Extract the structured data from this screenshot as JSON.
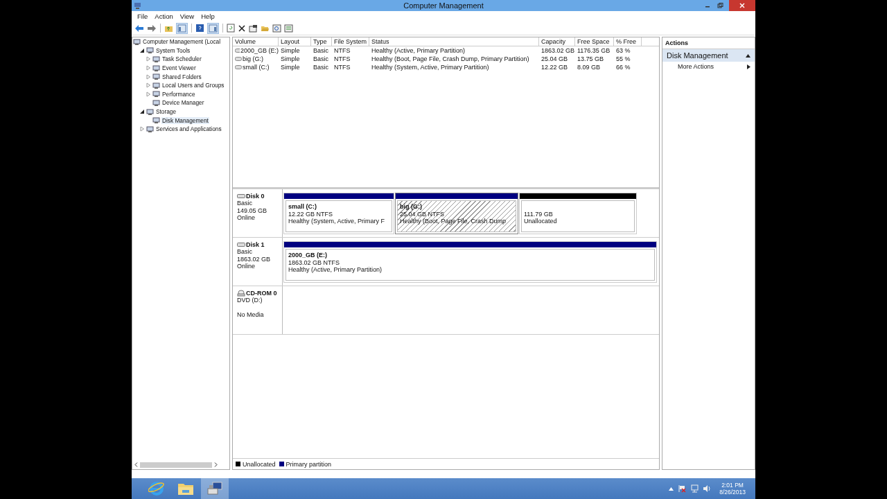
{
  "window": {
    "title": "Computer Management"
  },
  "menu": [
    "File",
    "Action",
    "View",
    "Help"
  ],
  "tree": [
    {
      "label": "Computer Management (Local",
      "expandable": false,
      "selected": false,
      "children": [
        {
          "label": "System Tools",
          "expandable": true,
          "expanded": true,
          "selected": false,
          "children": [
            {
              "label": "Task Scheduler",
              "expandable": true,
              "expanded": false,
              "selected": false
            },
            {
              "label": "Event Viewer",
              "expandable": true,
              "expanded": false,
              "selected": false
            },
            {
              "label": "Shared Folders",
              "expandable": true,
              "expanded": false,
              "selected": false
            },
            {
              "label": "Local Users and Groups",
              "expandable": true,
              "expanded": false,
              "selected": false
            },
            {
              "label": "Performance",
              "expandable": true,
              "expanded": false,
              "selected": false
            },
            {
              "label": "Device Manager",
              "expandable": false,
              "selected": false
            }
          ]
        },
        {
          "label": "Storage",
          "expandable": true,
          "expanded": true,
          "selected": false,
          "children": [
            {
              "label": "Disk Management",
              "expandable": false,
              "selected": true
            }
          ]
        },
        {
          "label": "Services and Applications",
          "expandable": true,
          "expanded": false,
          "selected": false
        }
      ]
    }
  ],
  "table": {
    "columns": [
      "Volume",
      "Layout",
      "Type",
      "File System",
      "Status",
      "Capacity",
      "Free Space",
      "% Free"
    ],
    "rows": [
      [
        "2000_GB (E:)",
        "Simple",
        "Basic",
        "NTFS",
        "Healthy (Active, Primary Partition)",
        "1863.02 GB",
        "1176.35 GB",
        "63 %"
      ],
      [
        "big (G:)",
        "Simple",
        "Basic",
        "NTFS",
        "Healthy (Boot, Page File, Crash Dump, Primary Partition)",
        "25.04 GB",
        "13.75 GB",
        "55 %"
      ],
      [
        "small (C:)",
        "Simple",
        "Basic",
        "NTFS",
        "Healthy (System, Active, Primary Partition)",
        "12.22 GB",
        "8.09 GB",
        "66 %"
      ]
    ]
  },
  "disks": [
    {
      "kind": "disk",
      "name": "Disk 0",
      "lines": [
        "Basic",
        "149.05 GB",
        "Online"
      ],
      "partitions": [
        {
          "kind": "primary",
          "selected": false,
          "name": "small  (C:)",
          "size": "12.22 GB NTFS",
          "status": "Healthy (System, Active, Primary F"
        },
        {
          "kind": "primary",
          "selected": true,
          "name": "big  (G:)",
          "size": "25.04 GB NTFS",
          "status": "Healthy (Boot, Page File, Crash Dump"
        },
        {
          "kind": "unallocated",
          "selected": false,
          "size": "111.79 GB",
          "status": "Unallocated"
        }
      ]
    },
    {
      "kind": "disk",
      "name": "Disk 1",
      "lines": [
        "Basic",
        "1863.02 GB",
        "Online"
      ],
      "partitions": [
        {
          "kind": "primary",
          "selected": false,
          "name": "2000_GB  (E:)",
          "size": "1863.02 GB NTFS",
          "status": "Healthy (Active, Primary Partition)"
        }
      ]
    },
    {
      "kind": "cdrom",
      "name": "CD-ROM 0",
      "lines": [
        "DVD (D:)",
        "No Media"
      ]
    }
  ],
  "legend": [
    {
      "label": "Unallocated",
      "color": "#000000"
    },
    {
      "label": "Primary partition",
      "color": "#000080"
    }
  ],
  "actions": {
    "title": "Actions",
    "section": "Disk Management",
    "items": [
      "More Actions"
    ]
  },
  "taskbar": {
    "apps": [
      {
        "kind": "browser",
        "selected": false
      },
      {
        "kind": "folder",
        "selected": false
      },
      {
        "kind": "computer",
        "selected": true
      }
    ],
    "time": "2:01 PM",
    "date": "8/26/2013"
  }
}
